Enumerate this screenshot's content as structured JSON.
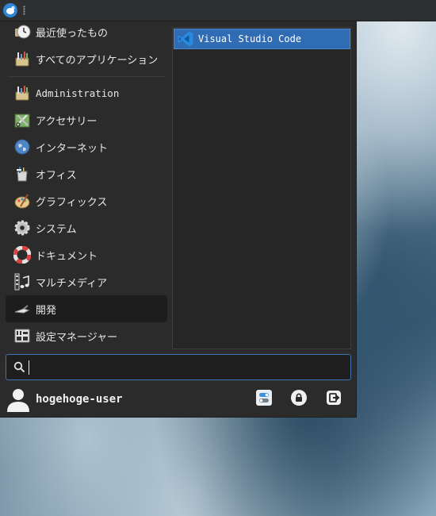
{
  "panel": {
    "launcher_icon": "xfce-mouse-icon",
    "handle_icon": "panel-drag-handle-icon"
  },
  "categories": [
    {
      "label": "最近使ったもの",
      "icon": "recent-clock-icon",
      "active": false
    },
    {
      "label": "すべてのアプリケーション",
      "icon": "all-applications-icon",
      "active": false
    },
    {
      "label": "Administration",
      "icon": "administration-icon",
      "active": false
    },
    {
      "label": "アクセサリー",
      "icon": "accessories-icon",
      "active": false
    },
    {
      "label": "インターネット",
      "icon": "internet-globe-icon",
      "active": false
    },
    {
      "label": "オフィス",
      "icon": "office-icon",
      "active": false
    },
    {
      "label": "グラフィックス",
      "icon": "graphics-palette-icon",
      "active": false
    },
    {
      "label": "システム",
      "icon": "system-gear-icon",
      "active": false
    },
    {
      "label": "ドキュメント",
      "icon": "documentation-lifebuoy-icon",
      "active": false
    },
    {
      "label": "マルチメディア",
      "icon": "multimedia-icon",
      "active": false
    },
    {
      "label": "開発",
      "icon": "development-trowel-icon",
      "active": true
    },
    {
      "label": "設定マネージャー",
      "icon": "settings-manager-icon",
      "active": false
    }
  ],
  "apps": [
    {
      "label": "Visual Studio Code",
      "icon": "vscode-icon",
      "selected": true
    }
  ],
  "search": {
    "value": "",
    "placeholder": "",
    "icon": "search-icon"
  },
  "user": {
    "name": "hogehoge-user",
    "avatar_icon": "user-avatar-icon"
  },
  "actions": [
    {
      "name": "settings-toggle",
      "icon": "settings-toggle-icon"
    },
    {
      "name": "lock-screen",
      "icon": "lock-icon"
    },
    {
      "name": "log-out",
      "icon": "logout-icon"
    }
  ],
  "colors": {
    "selection": "#2f6cb3",
    "active_category": "#1d1d1d",
    "menu_background": "#2b2b2b",
    "search_border": "#3d72b5"
  }
}
